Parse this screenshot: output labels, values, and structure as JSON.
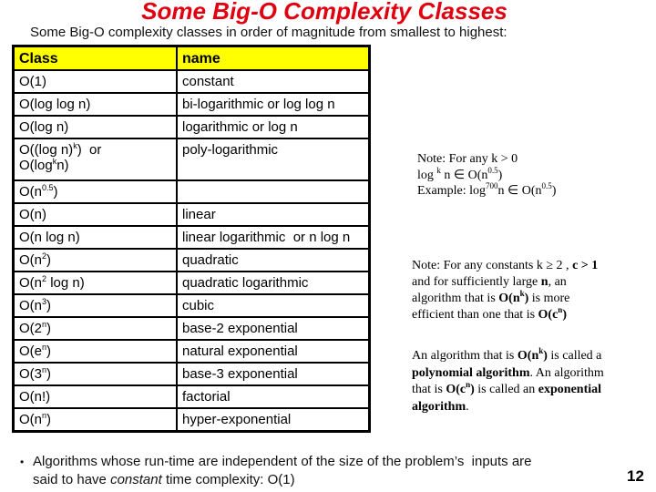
{
  "title": "Some Big-O Complexity Classes",
  "subtitle": "Some Big-O complexity classes in order of magnitude from smallest to highest:",
  "colors": {
    "title": "#e0000f",
    "header_bg": "#ffff00"
  },
  "table": {
    "headers": [
      "Class",
      "name"
    ],
    "rows": [
      {
        "class_pre": "O(1)",
        "class_sup": "",
        "class_post": "",
        "name": "constant"
      },
      {
        "class_pre": "O(log log n)",
        "class_sup": "",
        "class_post": "",
        "name": "bi-logarithmic or  log log n"
      },
      {
        "class_pre": "O(log n)",
        "class_sup": "",
        "class_post": "",
        "name": "logarithmic    or log n"
      },
      {
        "class_line1_pre": "O((log n)",
        "class_line1_sup": "k",
        "class_line1_post": ")  or",
        "class_line2_pre": "O(log",
        "class_line2_sup": "k",
        "class_line2_post": "n)",
        "name": "poly-logarithmic"
      },
      {
        "class_pre": "O(n",
        "class_sup": "0.5",
        "class_post": ")",
        "name": ""
      },
      {
        "class_pre": "O(n)",
        "class_sup": "",
        "class_post": "",
        "name": "linear"
      },
      {
        "class_pre": "O(n log n)",
        "class_sup": "",
        "class_post": "",
        "name": "linear logarithmic  or n log n"
      },
      {
        "class_pre": "O(n",
        "class_sup": "2",
        "class_post": ")",
        "name": "quadratic"
      },
      {
        "class_pre": "O(n",
        "class_sup": "2",
        "class_post": " log n)",
        "name": "quadratic logarithmic"
      },
      {
        "class_pre": "O(n",
        "class_sup": "3",
        "class_post": ")",
        "name": "cubic"
      },
      {
        "class_pre": "O(2",
        "class_sup": "n",
        "class_post": ")",
        "name": "base-2 exponential"
      },
      {
        "class_pre": "O(e",
        "class_sup": "n",
        "class_post": ")",
        "name": "natural exponential"
      },
      {
        "class_pre": "O(3",
        "class_sup": "n",
        "class_post": ")",
        "name": "base-3 exponential"
      },
      {
        "class_pre": "O(n!)",
        "class_sup": "",
        "class_post": "",
        "name": "factorial"
      },
      {
        "class_pre": "O(n",
        "class_sup": "n",
        "class_post": ")",
        "name": "hyper-exponential"
      }
    ]
  },
  "notes": {
    "note1": {
      "line1": "Note: For any k > 0",
      "line2_pre": "log ",
      "line2_sup": "k",
      "line2_mid": " n ∈ O(n",
      "line2_sup2": "0.5",
      "line2_post": ")",
      "line3_pre": "Example: log",
      "line3_sup": "700",
      "line3_mid": "n ∈ O(n",
      "line3_sup2": "0.5",
      "line3_post": ")"
    },
    "note2": {
      "t1": "Note: For any constants k ≥ 2 , ",
      "b1": "c > 1",
      "t2": "and for sufficiently large ",
      "b2": "n",
      "t3": ", an",
      "t4": "algorithm that is ",
      "b3_pre": "O(n",
      "b3_sup": "k",
      "b3_post": ")",
      "t5": " is more",
      "t6": "efficient than one that is ",
      "b4_pre": "O(c",
      "b4_sup": "n",
      "b4_post": ")"
    },
    "note3": {
      "t1": "An algorithm that is ",
      "b1_pre": "O(n",
      "b1_sup": "k",
      "b1_post": ")",
      "t2": " is called a",
      "b2": "polynomial algorithm",
      "t3": ". An algorithm",
      "t4": "that is ",
      "b3_pre": "O(c",
      "b3_sup": "n",
      "b3_post": ")",
      "t5": " is called an ",
      "b4": "exponential",
      "b5": "algorithm",
      "t6": "."
    }
  },
  "bullet": {
    "symbol": "•",
    "line1": "Algorithms whose run-time are independent of the size of the problem’s  inputs are",
    "line2_pre": "said to have ",
    "line2_em": "constant",
    "line2_post": " time complexity: O(1)"
  },
  "page_number": "12"
}
